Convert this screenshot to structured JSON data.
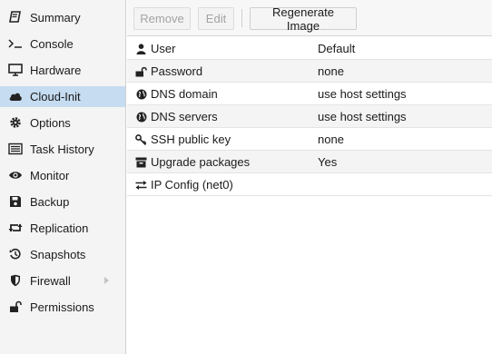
{
  "sidebar": {
    "items": [
      {
        "label": "Summary",
        "icon": "book-icon"
      },
      {
        "label": "Console",
        "icon": "terminal-icon"
      },
      {
        "label": "Hardware",
        "icon": "monitor-icon"
      },
      {
        "label": "Cloud-Init",
        "icon": "cloud-icon",
        "active": true
      },
      {
        "label": "Options",
        "icon": "gear-icon"
      },
      {
        "label": "Task History",
        "icon": "list-icon"
      },
      {
        "label": "Monitor",
        "icon": "eye-icon"
      },
      {
        "label": "Backup",
        "icon": "floppy-icon"
      },
      {
        "label": "Replication",
        "icon": "retweet-icon"
      },
      {
        "label": "Snapshots",
        "icon": "history-icon"
      },
      {
        "label": "Firewall",
        "icon": "shield-icon",
        "has_submenu": true
      },
      {
        "label": "Permissions",
        "icon": "unlock-icon"
      }
    ]
  },
  "toolbar": {
    "remove_label": "Remove",
    "edit_label": "Edit",
    "regenerate_label": "Regenerate Image"
  },
  "grid": {
    "rows": [
      {
        "key": "User",
        "value": "Default",
        "icon": "user-icon"
      },
      {
        "key": "Password",
        "value": "none",
        "icon": "unlock-icon"
      },
      {
        "key": "DNS domain",
        "value": "use host settings",
        "icon": "globe-icon"
      },
      {
        "key": "DNS servers",
        "value": "use host settings",
        "icon": "globe-icon"
      },
      {
        "key": "SSH public key",
        "value": "none",
        "icon": "key-icon"
      },
      {
        "key": "Upgrade packages",
        "value": "Yes",
        "icon": "archive-icon"
      },
      {
        "key": "IP Config (net0)",
        "value": "",
        "icon": "exchange-icon"
      }
    ]
  },
  "colors": {
    "active_nav_bg": "#c5dcf1",
    "sidebar_bg": "#f4f4f4",
    "toolbar_bg": "#f7f7f7",
    "alt_row_bg": "#f4f4f4"
  }
}
